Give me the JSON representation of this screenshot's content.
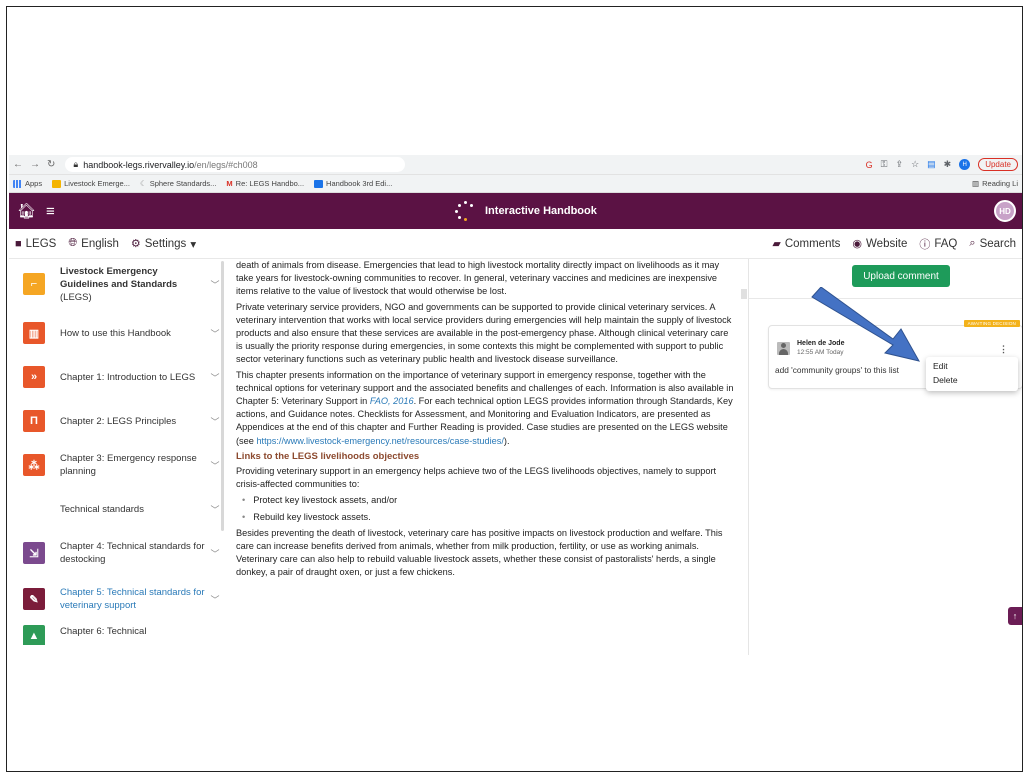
{
  "browser": {
    "url_host": "handbook-legs.rivervalley.io",
    "url_path": "/en/legs/#ch008",
    "update_label": "Update",
    "profile_initial": "H",
    "bookmarks": [
      {
        "label": "Apps",
        "color": "#4285f4"
      },
      {
        "label": "Livestock Emerge...",
        "color": "#f4b400"
      },
      {
        "label": "Sphere Standards...",
        "color": "#999999"
      },
      {
        "label": "Re: LEGS Handbo...",
        "color": "#d93025"
      },
      {
        "label": "Handbook 3rd Edi...",
        "color": "#1a73e8"
      }
    ],
    "reading_list": "Reading Li"
  },
  "header": {
    "title": "Interactive Handbook",
    "avatar_initials": "HD",
    "brand_color": "#5b1244"
  },
  "toolbar": {
    "legs": "LEGS",
    "language": "English",
    "settings": "Settings",
    "comments": "Comments",
    "website": "Website",
    "faq": "FAQ",
    "search": "Search"
  },
  "sidebar": {
    "items": [
      {
        "label": "Livestock Emergency Guidelines and Standards",
        "sub": "(LEGS)",
        "icon": "legs-logo-icon",
        "color": "#f5a623"
      },
      {
        "label": "How to use this Handbook",
        "icon": "book-icon",
        "color": "#e8572a"
      },
      {
        "label": "Chapter 1: Introduction to LEGS",
        "icon": "chevrons-icon",
        "color": "#e8572a"
      },
      {
        "label": "Chapter 2: LEGS Principles",
        "icon": "pillar-icon",
        "color": "#e8572a"
      },
      {
        "label": "Chapter 3: Emergency response planning",
        "icon": "people-icon",
        "color": "#e8572a"
      },
      {
        "label": "Technical standards"
      },
      {
        "label": "Chapter 4: Technical standards for destocking",
        "icon": "destocking-icon",
        "color": "#7b4a8e"
      },
      {
        "label": "Chapter 5: Technical standards for veterinary support",
        "icon": "syringe-icon",
        "color": "#7b1c3a"
      },
      {
        "label": "Chapter 6: Technical",
        "icon": "feed-icon",
        "color": "#2e9b57"
      }
    ]
  },
  "content": {
    "p1": "death of animals from disease. Emergencies that lead to high livestock mortality directly impact on livelihoods as it may take years for livestock-owning communities to recover. In general, veterinary vaccines and medicines are inexpensive items relative to the value of livestock that would otherwise be lost.",
    "p2": "Private veterinary service providers, NGO and governments can be supported to provide clinical veterinary services. A veterinary intervention that works with local service providers during emergencies will help maintain the supply of livestock products and also ensure that these services are available in the post-emergency phase. Although clinical veterinary care is usually the priority response during emergencies, in some contexts this might be complemented with support to public sector veterinary functions such as veterinary public health and livestock disease surveillance.",
    "p3a": "This chapter presents information on the importance of veterinary support in emergency response, together with the technical options for veterinary support and the associated benefits and challenges of each. Information is also available in Chapter 5: Veterinary Support in ",
    "p3_link1": "FAO, 2016",
    "p3b": ". For each technical option LEGS provides information through Standards, Key actions, and Guidance notes. Checklists for Assessment, and Monitoring and Evaluation Indicators, are presented as Appendices at the end of this chapter and Further Reading is provided. Case studies are presented on the LEGS website (see ",
    "p3_link2": "https://www.livestock-emergency.net/resources/case-studies/",
    "p3c": ").",
    "heading": "Links to the LEGS livelihoods objectives",
    "p4": "Providing veterinary support in an emergency helps achieve two of the LEGS livelihoods objectives, namely to support crisis-affected communities to:",
    "bullets": [
      "Protect key livestock assets, and/or",
      "Rebuild key livestock assets."
    ],
    "p5": "Besides preventing the death of livestock, veterinary care has positive impacts on livestock production and welfare. This care can increase benefits derived from animals, whether from milk production, fertility, or use as working animals. Veterinary care can also help to rebuild valuable livestock assets, whether these consist of pastoralists' herds, a single donkey, a pair of draught oxen, or just a few chickens."
  },
  "comments": {
    "upload_label": "Upload comment",
    "upload_color": "#1e9b5a",
    "card": {
      "badge": "AWAITING DECISION",
      "author": "Helen de Jode",
      "time": "12:55 AM Today",
      "text": "add 'community groups' to this list"
    },
    "menu": [
      "Edit",
      "Delete"
    ]
  }
}
